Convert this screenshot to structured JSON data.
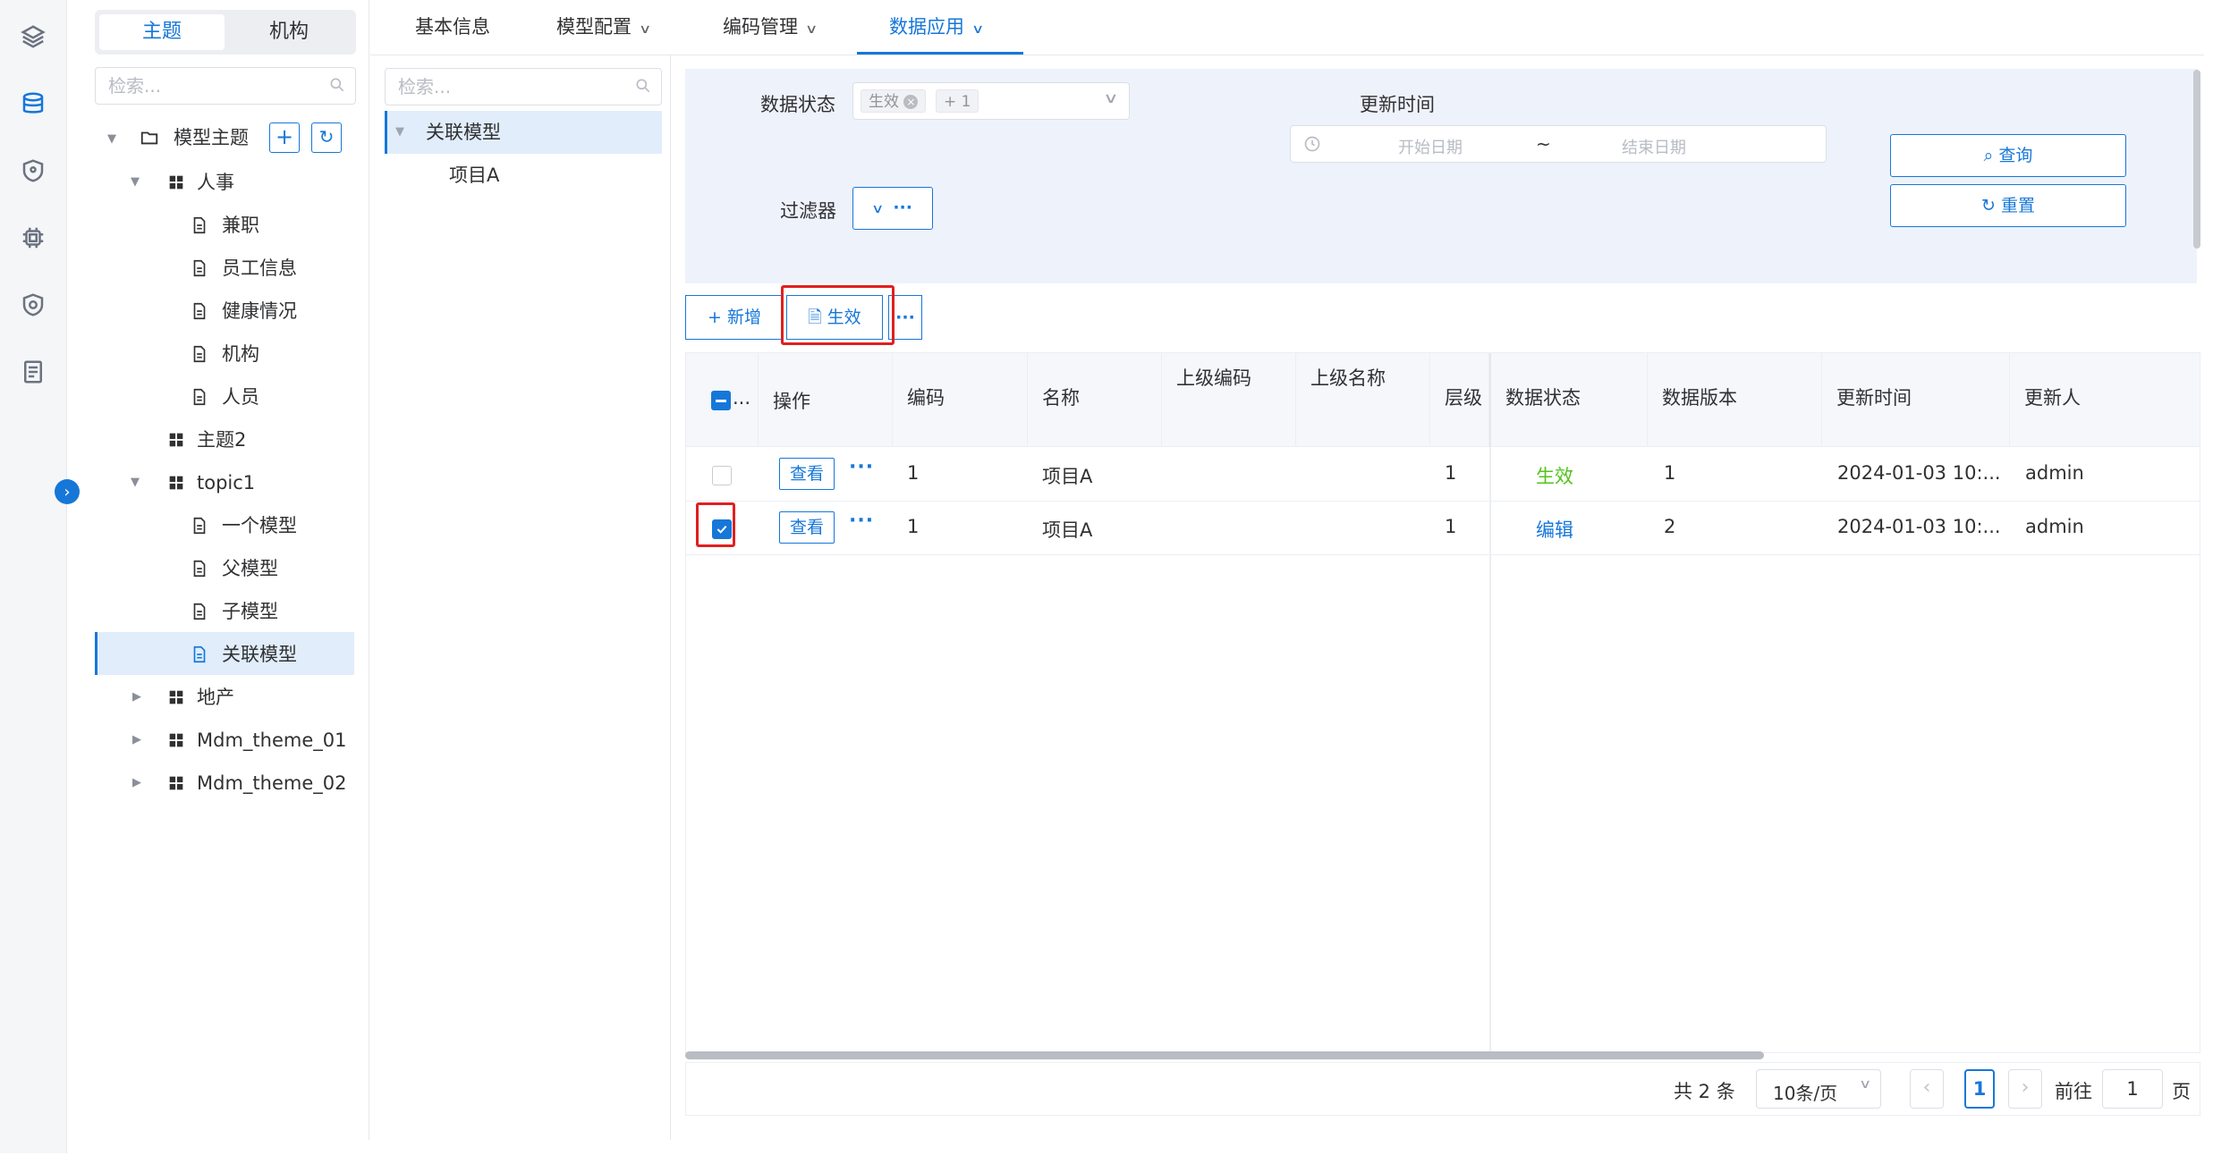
{
  "rail": {
    "icons": [
      "layers-icon",
      "database-icon",
      "shield-icon",
      "chip-icon",
      "security-icon",
      "document-list-icon"
    ]
  },
  "segment": {
    "left": "主题",
    "right": "机构"
  },
  "tree_search": {
    "placeholder": "检索..."
  },
  "tree": {
    "root": "模型主题",
    "renshi": "人事",
    "renshi_children": [
      "兼职",
      "员工信息",
      "健康情况",
      "机构",
      "人员"
    ],
    "zhuti2": "主题2",
    "topic1": "topic1",
    "topic1_children": [
      "一个模型",
      "父模型",
      "子模型",
      "关联模型"
    ],
    "dichan": "地产",
    "mdm1": "Mdm_theme_01",
    "mdm2": "Mdm_theme_02"
  },
  "tabs": [
    "基本信息",
    "模型配置",
    "编码管理",
    "数据应用"
  ],
  "model_panel": {
    "search_placeholder": "检索...",
    "parent": "关联模型",
    "child": "项目A"
  },
  "filter": {
    "status_label": "数据状态",
    "status_tag": "生效",
    "status_more": "+ 1",
    "update_time_label": "更新时间",
    "start_placeholder": "开始日期",
    "tilde": "~",
    "end_placeholder": "结束日期",
    "filter_label": "过滤器",
    "filter_more": "···",
    "query_button": "查询",
    "reset_button": "重置"
  },
  "toolbar": {
    "add": "新增",
    "activate": "生效",
    "more": "···"
  },
  "table": {
    "headers": [
      "操作",
      "编码",
      "名称",
      "上级编码",
      "上级名称",
      "层级",
      "数据状态",
      "数据版本",
      "更新时间",
      "更新人"
    ],
    "select_all_suffix": "...",
    "rows": [
      {
        "checked": false,
        "action": "查看",
        "code": "1",
        "name": "项目A",
        "parent_code": "",
        "parent_name": "",
        "level": "1",
        "status": "生效",
        "status_color": "#52c41a",
        "version": "1",
        "updated": "2024-01-03 10:...",
        "updater": "admin"
      },
      {
        "checked": true,
        "action": "查看",
        "code": "1",
        "name": "项目A",
        "parent_code": "",
        "parent_name": "",
        "level": "1",
        "status": "编辑",
        "status_color": "#1677d9",
        "version": "2",
        "updated": "2024-01-03 10:...",
        "updater": "admin"
      }
    ]
  },
  "pager": {
    "total": "共 2 条",
    "page_size": "10条/页",
    "current_page": "1",
    "goto_label": "前往",
    "goto_value": "1",
    "page_suffix": "页"
  },
  "colors": {
    "accent": "#1677d9",
    "highlight_box": "#e02020",
    "active_status": "#52c41a"
  }
}
